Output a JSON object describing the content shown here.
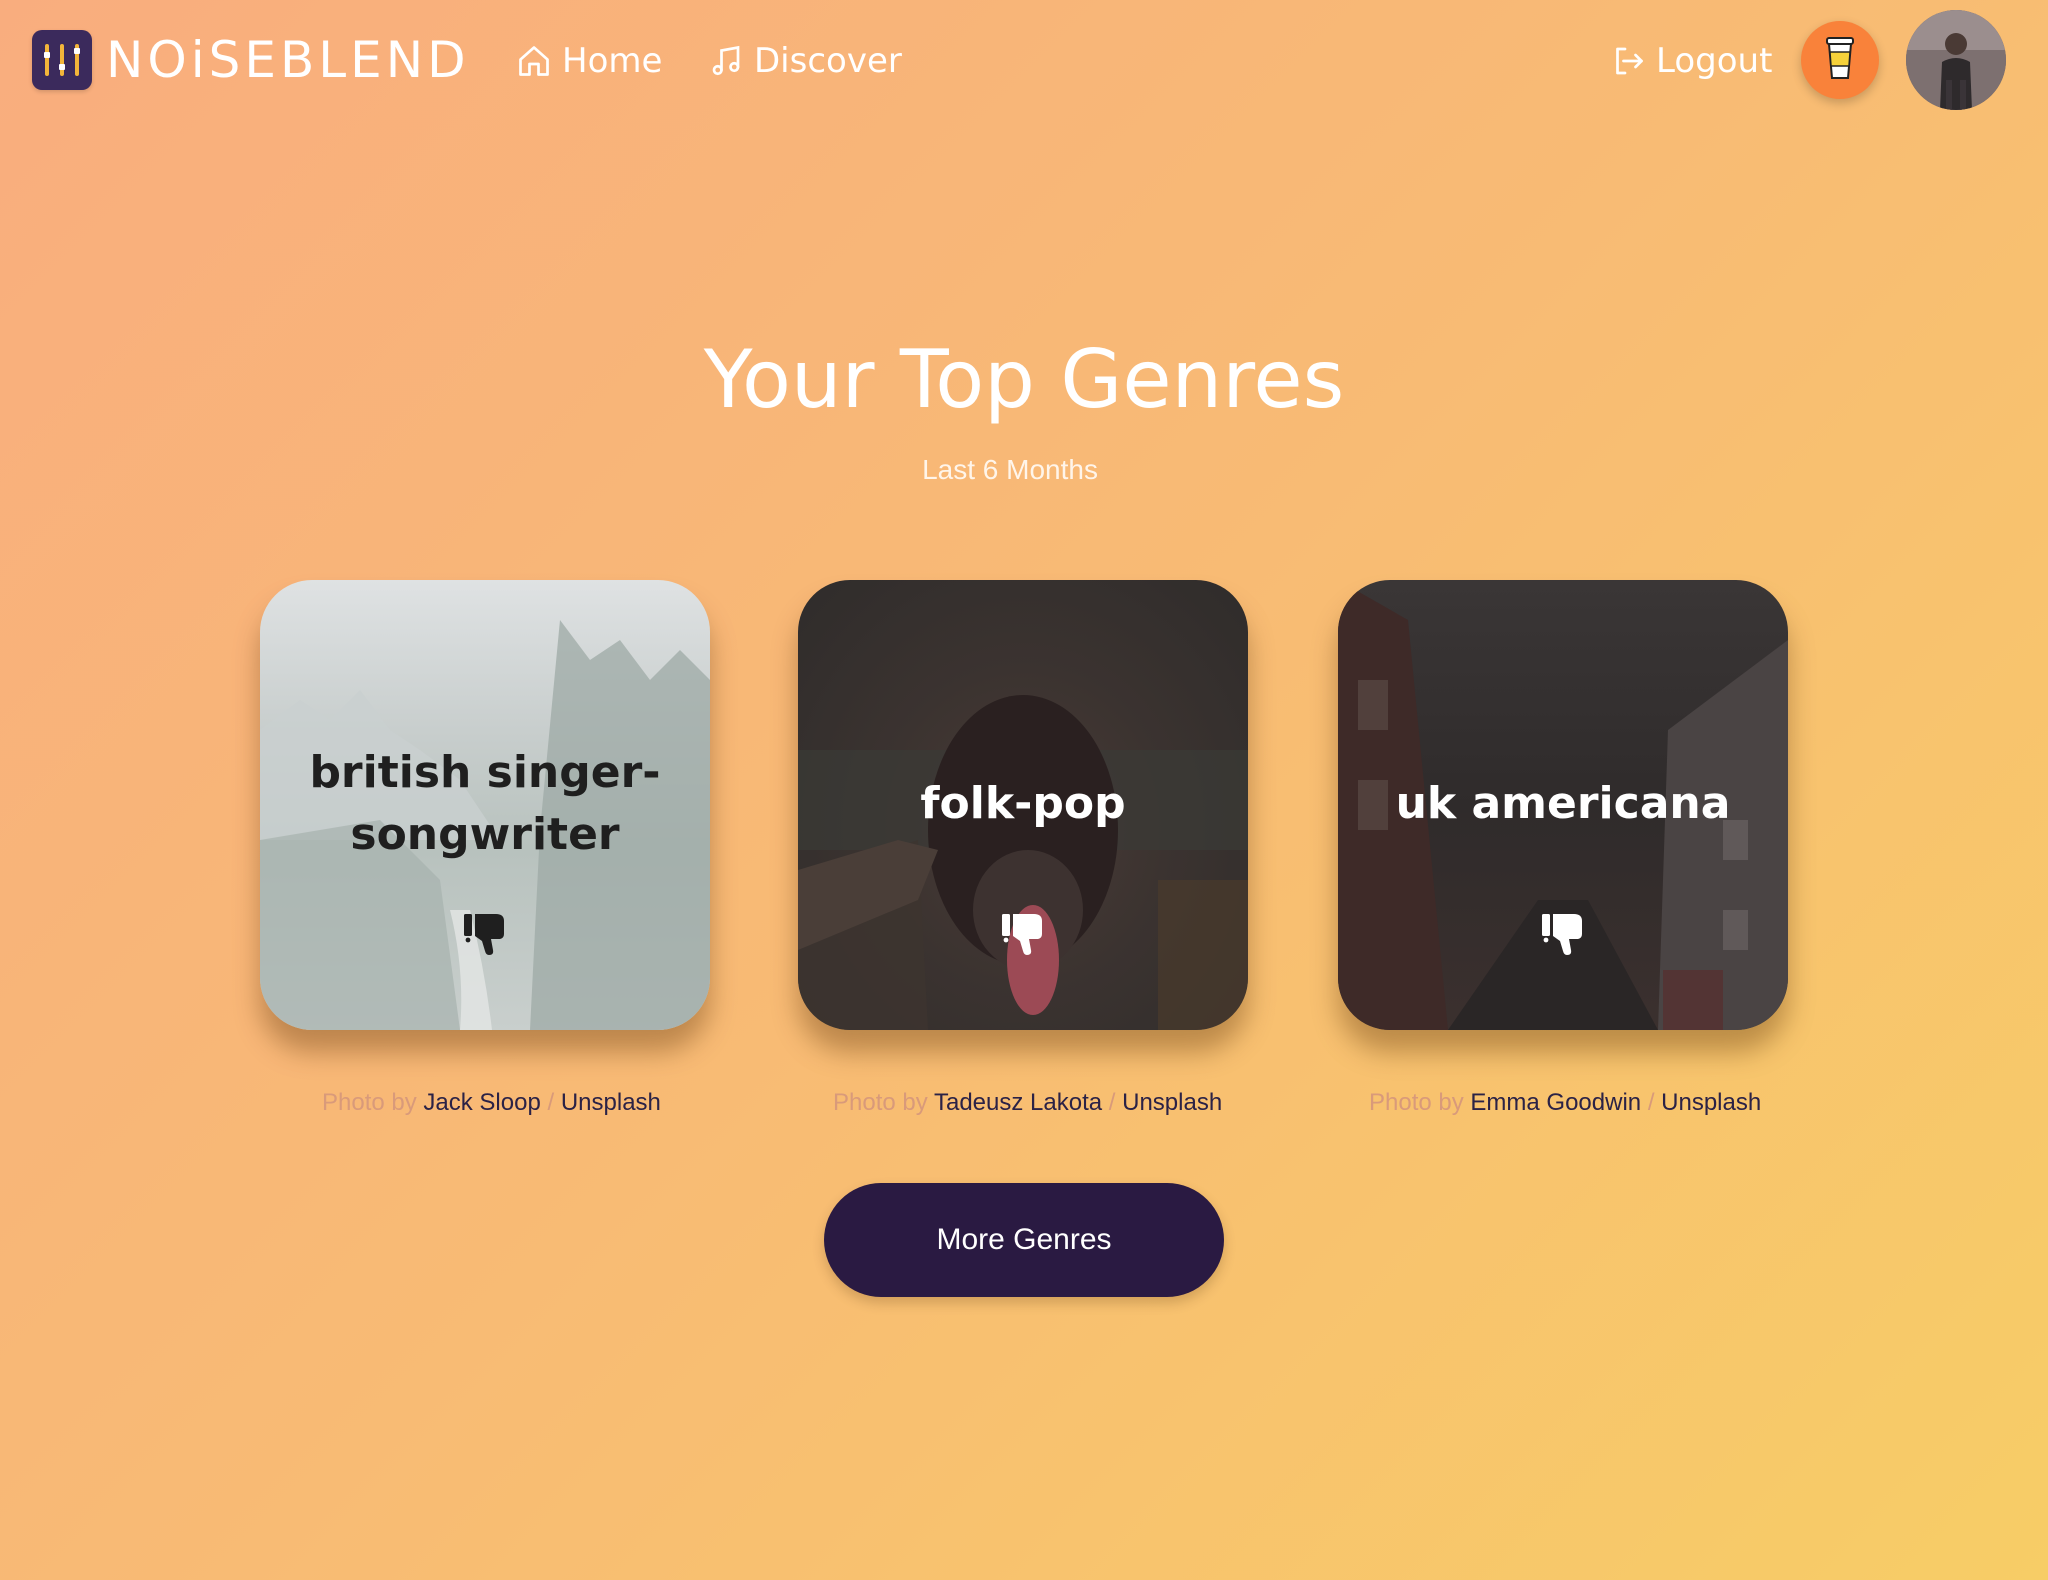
{
  "header": {
    "brand": "NOiSEBLEND",
    "nav": {
      "home": "Home",
      "discover": "Discover",
      "logout": "Logout"
    },
    "icons": {
      "logo": "equalizer-logo-icon",
      "home": "home-icon",
      "discover": "music-note-icon",
      "logout": "logout-icon",
      "coffee": "coffee-cup-icon",
      "avatar": "user-avatar"
    }
  },
  "main": {
    "title": "Your Top Genres",
    "subtitle": "Last 6 Months"
  },
  "cards": [
    {
      "genre": "british singer-songwriter",
      "photo_prefix": "Photo by",
      "photographer": "Jack Sloop",
      "separator": "/",
      "source": "Unsplash"
    },
    {
      "genre": "folk-pop",
      "photo_prefix": "Photo by",
      "photographer": "Tadeusz Lakota",
      "separator": "/",
      "source": "Unsplash"
    },
    {
      "genre": "uk americana",
      "photo_prefix": "Photo by",
      "photographer": "Emma Goodwin",
      "separator": "/",
      "source": "Unsplash"
    }
  ],
  "more_button": "More Genres",
  "colors": {
    "gradient_start": "#f9ad7e",
    "gradient_end": "#f7cd66",
    "button_dark": "#2a1a42",
    "coffee_orange": "#f9823a",
    "logo_bg": "#3b2a5c"
  }
}
